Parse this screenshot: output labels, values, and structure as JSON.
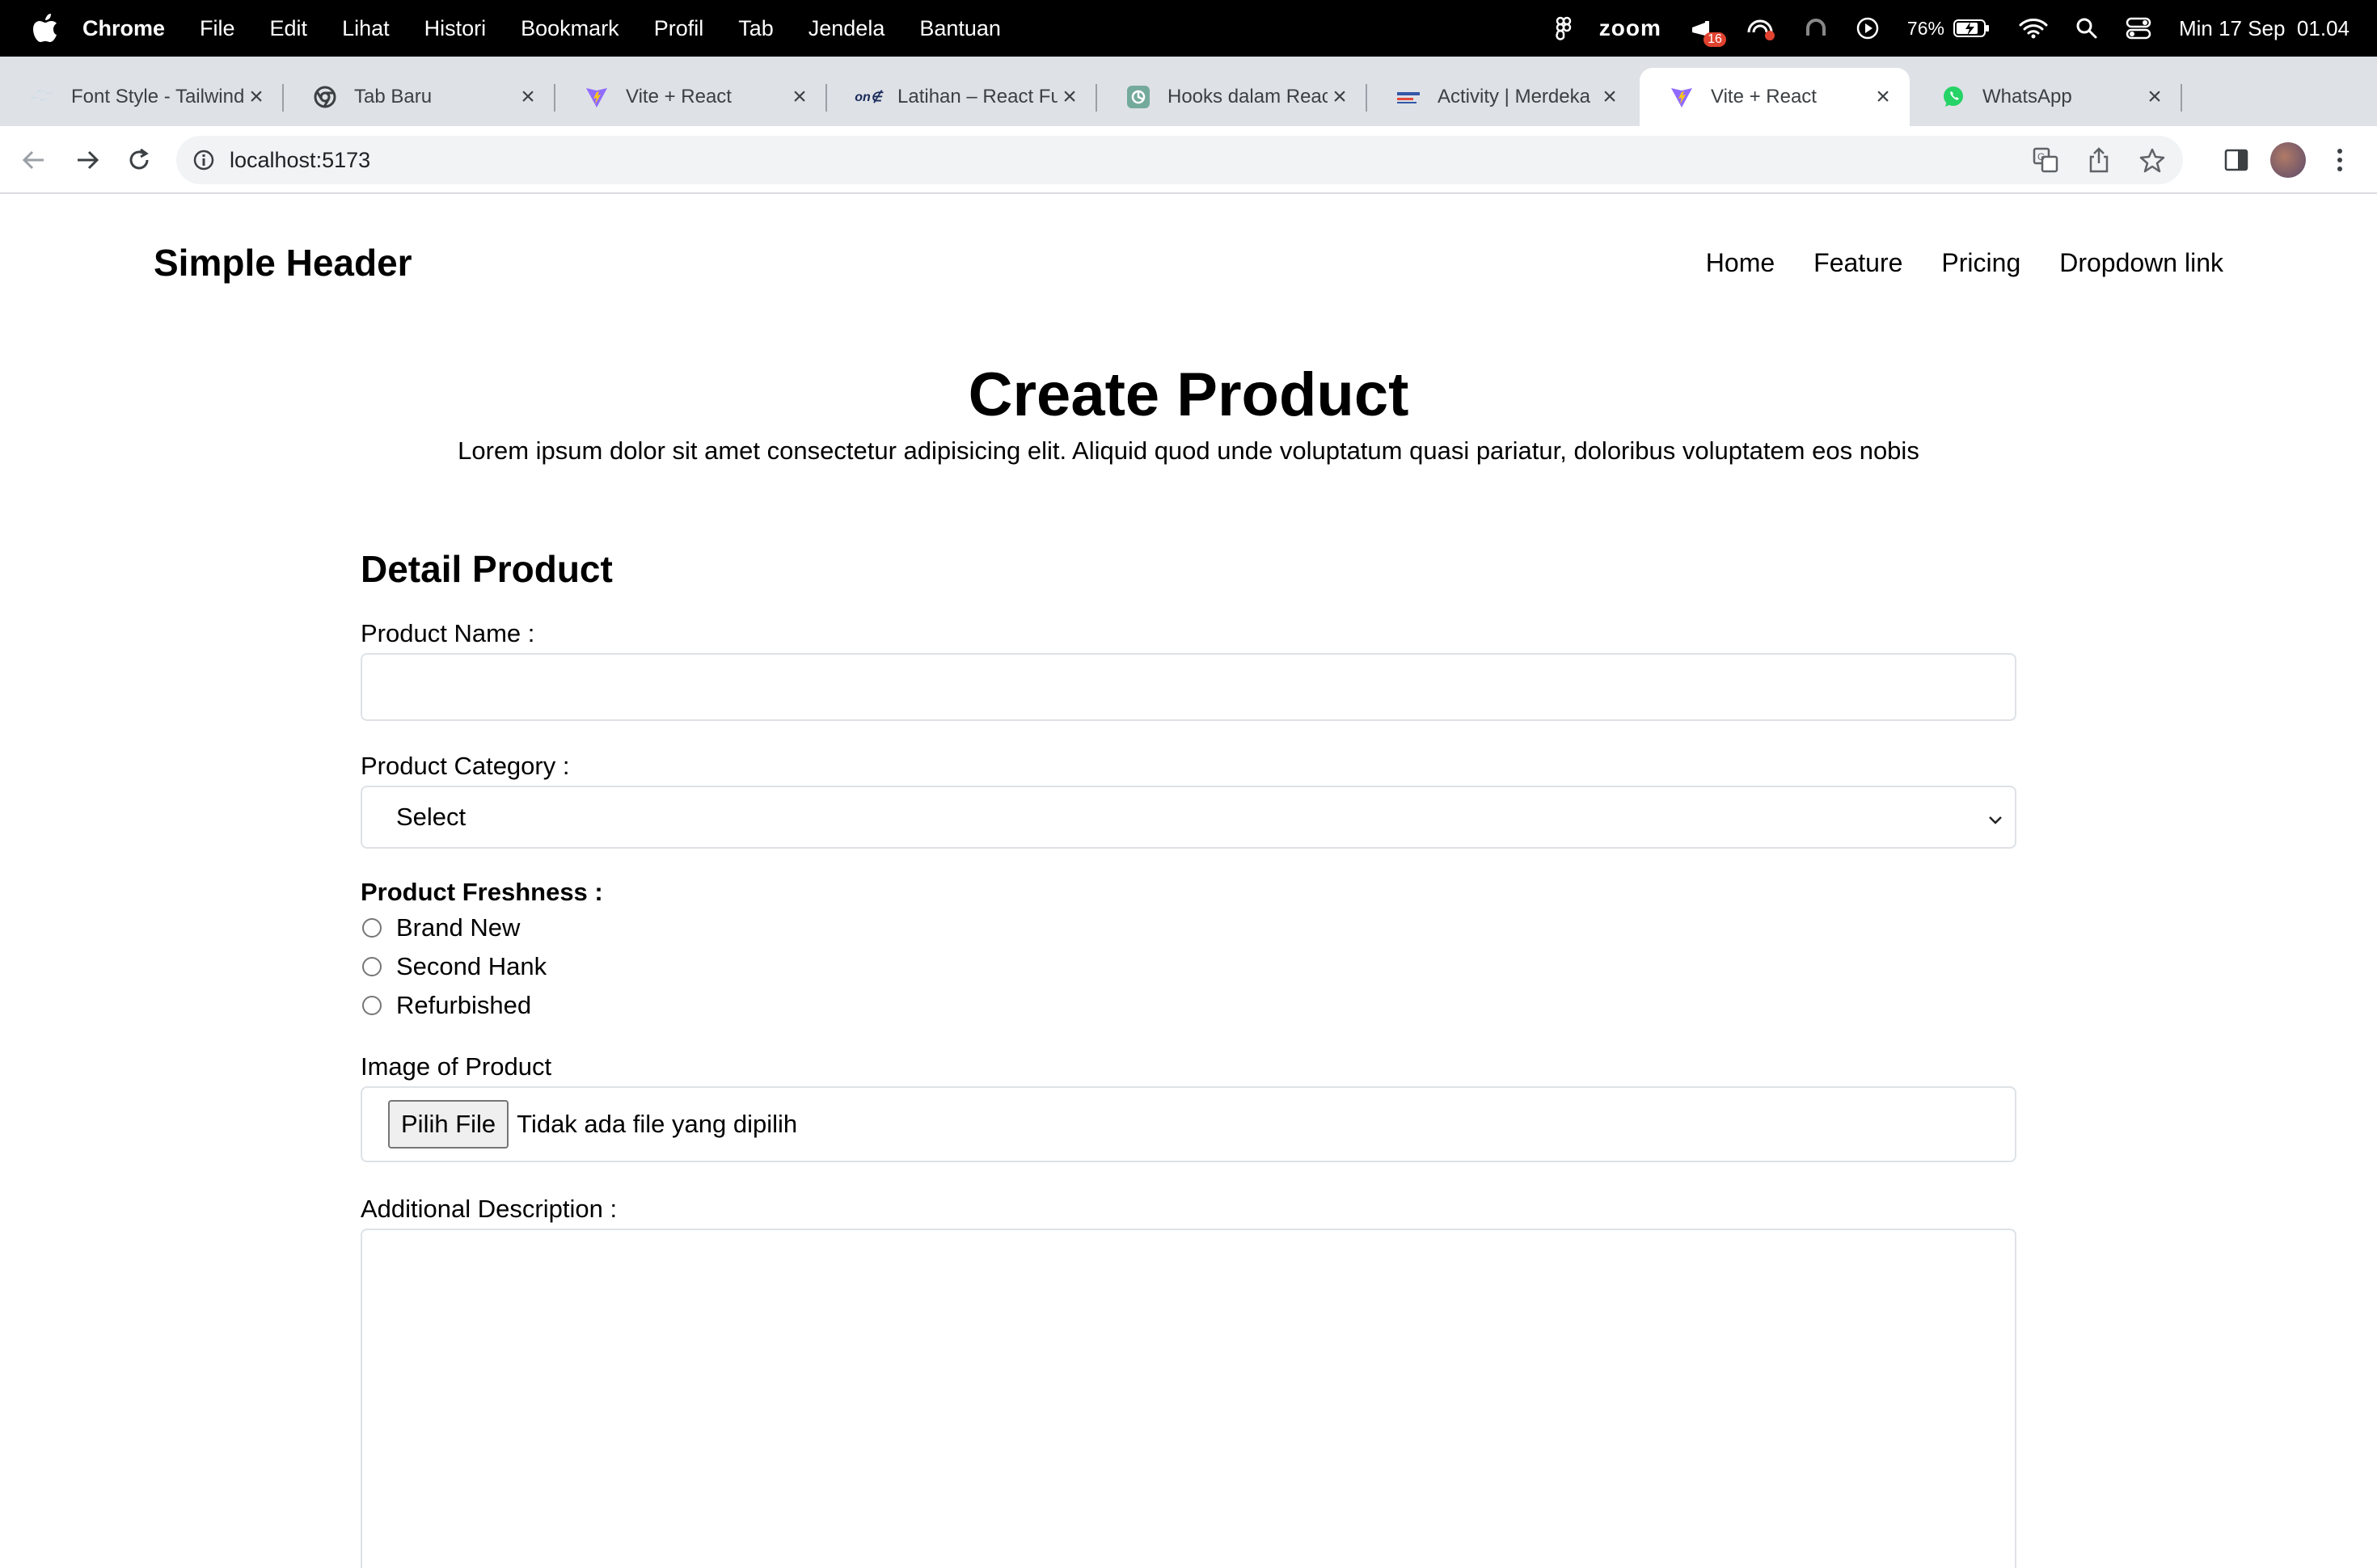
{
  "menubar": {
    "app": "Chrome",
    "items": [
      "File",
      "Edit",
      "Lihat",
      "Histori",
      "Bookmark",
      "Profil",
      "Tab",
      "Jendela",
      "Bantuan"
    ],
    "zoom_label": "zoom",
    "zoom_badge": "16",
    "battery": "76%",
    "datetime": "Min 17 Sep  01.04"
  },
  "tabs": [
    {
      "title": "Font Style - Tailwind",
      "icon": "tailwind-icon"
    },
    {
      "title": "Tab Baru",
      "icon": "chrome-icon"
    },
    {
      "title": "Vite + React",
      "icon": "vite-icon"
    },
    {
      "title": "Latihan – React Fu",
      "icon": "one-icon"
    },
    {
      "title": "Hooks dalam React",
      "icon": "openai-icon"
    },
    {
      "title": "Activity | Merdeka",
      "icon": "merdeka-icon"
    },
    {
      "title": "Vite + React",
      "icon": "vite-icon",
      "active": true
    },
    {
      "title": "WhatsApp",
      "icon": "whatsapp-icon"
    }
  ],
  "toolbar": {
    "url": "localhost:5173"
  },
  "site": {
    "brand": "Simple Header",
    "nav": [
      "Home",
      "Feature",
      "Pricing",
      "Dropdown link"
    ]
  },
  "hero": {
    "title": "Create Product",
    "subtitle": "Lorem ipsum dolor sit amet consectetur adipisicing elit. Aliquid quod unde voluptatum quasi pariatur, doloribus voluptatem eos nobis"
  },
  "form": {
    "section_title": "Detail Product",
    "name_label": "Product Name :",
    "name_value": "",
    "category_label": "Product Category :",
    "category_selected": "Select",
    "freshness_label": "Product Freshness :",
    "freshness_options": [
      "Brand New",
      "Second Hank",
      "Refurbished"
    ],
    "image_label": "Image of Product",
    "file_button": "Pilih File",
    "file_status": "Tidak ada file yang dipilih",
    "description_label": "Additional Description :"
  },
  "colors": {
    "menubar_bg": "#000000",
    "tabstrip_bg": "#dee1e6",
    "field_border": "#dee2e6"
  }
}
